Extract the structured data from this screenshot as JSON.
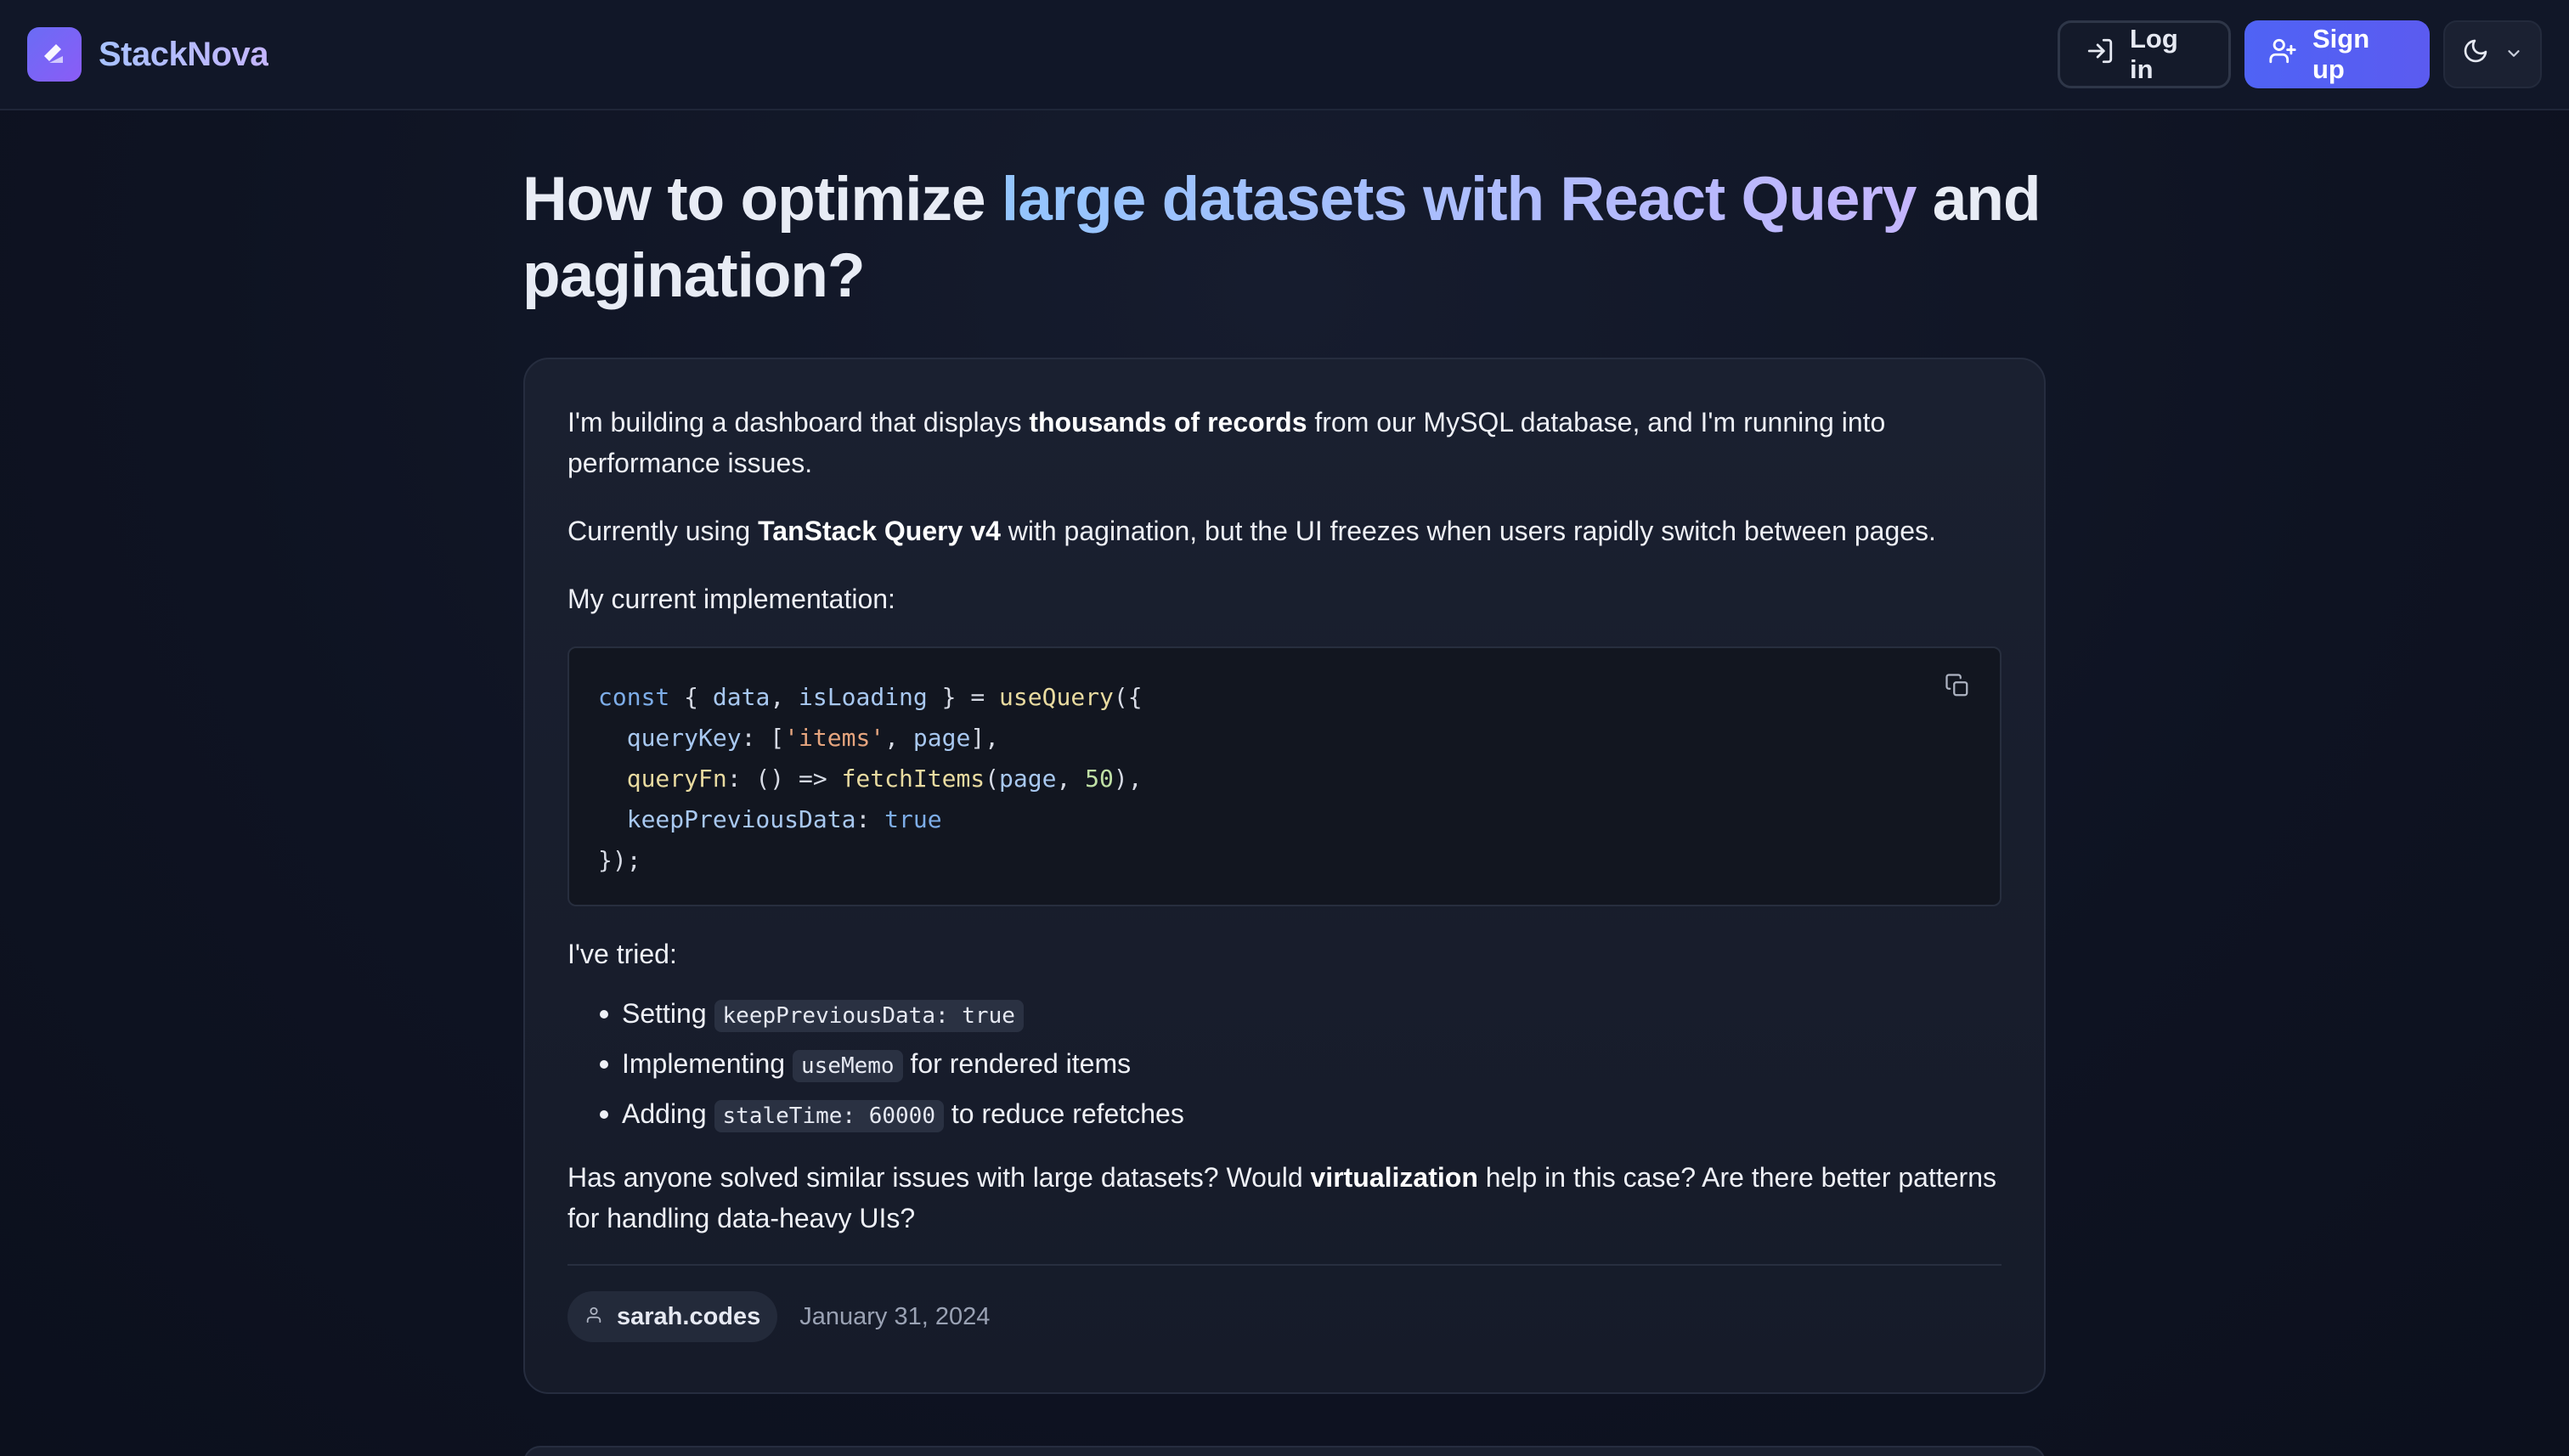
{
  "brand": {
    "name": "StackNova"
  },
  "header": {
    "login_label": "Log in",
    "signup_label": "Sign up"
  },
  "question": {
    "title_part1": "How to optimize ",
    "title_highlight": "large datasets with React Query",
    "title_part2": " and pagination?",
    "p1_a": "I'm building a dashboard that displays ",
    "p1_bold": "thousands of records",
    "p1_b": " from our MySQL database, and I'm running into performance issues.",
    "p2_a": "Currently using ",
    "p2_bold": "TanStack Query v4",
    "p2_b": " with pagination, but the UI freezes when users rapidly switch between pages.",
    "p3": "My current implementation:",
    "code": {
      "l1_const": "const",
      "l1_open": " { ",
      "l1_data": "data",
      "l1_comma": ", ",
      "l1_isLoading": "isLoading",
      "l1_close": " } = ",
      "l1_fn": "useQuery",
      "l1_end": "({",
      "l2_key": "  queryKey",
      "l2_colon": ": [",
      "l2_str": "'items'",
      "l2_comma": ", ",
      "l2_page": "page",
      "l2_end": "],",
      "l3_key": "  queryFn",
      "l3_mid": ": () => ",
      "l3_fn": "fetchItems",
      "l3_paren": "(",
      "l3_page": "page",
      "l3_comma": ", ",
      "l3_num": "50",
      "l3_end": "),",
      "l4_key": "  keepPreviousData",
      "l4_colon": ": ",
      "l4_val": "true",
      "l5": "});"
    },
    "p4": "I've tried:",
    "bullets": [
      {
        "pre": "Setting ",
        "code": "keepPreviousData: true",
        "post": ""
      },
      {
        "pre": "Implementing ",
        "code": "useMemo",
        "post": " for rendered items"
      },
      {
        "pre": "Adding ",
        "code": "staleTime: 60000",
        "post": " to reduce refetches"
      }
    ],
    "p5_a": "Has anyone solved similar issues with large datasets? Would ",
    "p5_bold": "virtualization",
    "p5_b": " help in this case? Are there better patterns for handling data-heavy UIs?",
    "author": "sarah.codes",
    "date": "January 31, 2024"
  },
  "colors": {
    "accent": "#5b5bf0",
    "background": "#0f1424",
    "card": "#1a2030"
  },
  "icons": {
    "logo": "stacknova-logo-icon",
    "login": "login-icon",
    "signup": "user-plus-icon",
    "theme": "moon-icon",
    "dropdown": "chevron-down-icon",
    "copy": "copy-icon",
    "author": "user-icon"
  }
}
